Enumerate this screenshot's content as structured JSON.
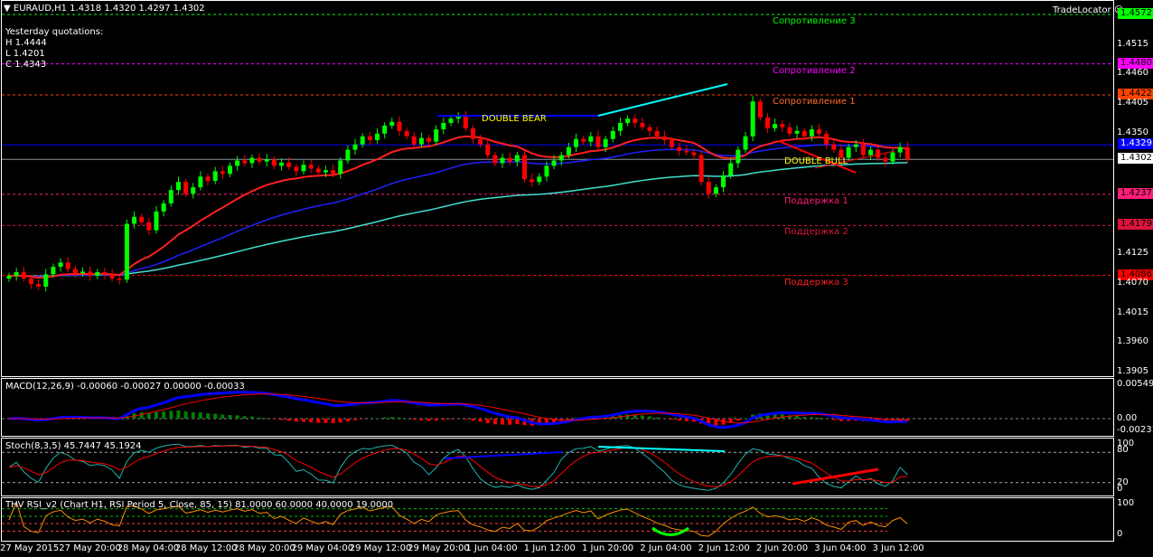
{
  "header": {
    "symbol_line": "EURAUD,H1  1.4318 1.4320 1.4297 1.4302",
    "tradelocator": "TradeLocator"
  },
  "yesterday": {
    "title": "Yesterday quotations:",
    "h": "H 1.4444",
    "l": "L 1.4201",
    "c": "C 1.4343"
  },
  "price_axis": [
    "1.4515",
    "1.4460",
    "1.4405",
    "1.4350",
    "1.4125",
    "1.4070",
    "1.4015",
    "1.3960",
    "1.3905"
  ],
  "levels": [
    {
      "name": "Сопротивление 3",
      "price": 1.4572,
      "label": "1.4572",
      "color": "#00ff00",
      "text_color": "#00ff00"
    },
    {
      "name": "Сопротивление 2",
      "price": 1.448,
      "label": "1.4480",
      "color": "#ff00ff",
      "text_color": "#ff00ff"
    },
    {
      "name": "Сопротивление 1",
      "price": 1.4422,
      "label": "1.4422",
      "color": "#ff4500",
      "text_color": "#ff6a2a"
    },
    {
      "name": "Поддержка 1",
      "price": 1.4237,
      "label": "1.4237",
      "color": "#ff1e78",
      "text_color": "#ff1e78"
    },
    {
      "name": "Поддержка 2",
      "price": 1.4179,
      "label": "1.4179",
      "color": "#dc143c",
      "text_color": "#dc143c"
    },
    {
      "name": "Поддержка 3",
      "price": 1.4086,
      "label": "1.4086",
      "color": "#ff0000",
      "text_color": "#ff2020"
    }
  ],
  "blue_line": {
    "price": 1.4329,
    "label": "1.4329",
    "color": "#0000ff"
  },
  "current_price": {
    "price": 1.4302,
    "label": "1.4302"
  },
  "annotations": {
    "bear": "DOUBLE  BEAR",
    "bull": "DOUBLE   BULL"
  },
  "macd": {
    "title": "MACD(12,26,9) -0.00060 -0.00027 0.00000 -0.00033",
    "axis": [
      "0.00549",
      "0.00",
      "-0.00231"
    ]
  },
  "stoch": {
    "title": "Stoch(8,3,5) 45.7447 45.1924",
    "axis": [
      "100",
      "80",
      "20",
      "0"
    ]
  },
  "rsi": {
    "title": "THV RSI_v2  (Chart H1,  RSI Period 5,  Close,  85,  15)  81.0000 60.0000 40.0000 19.0000",
    "axis": [
      "100",
      "0"
    ]
  },
  "time_axis": [
    "27 May 2015",
    "27 May 20:00",
    "28 May 04:00",
    "28 May 12:00",
    "28 May 20:00",
    "29 May 04:00",
    "29 May 12:00",
    "29 May 20:00",
    "1 Jun 04:00",
    "1 Jun 12:00",
    "1 Jun 20:00",
    "2 Jun 04:00",
    "2 Jun 12:00",
    "2 Jun 20:00",
    "3 Jun 04:00",
    "3 Jun 12:00"
  ],
  "chart_data": {
    "type": "candlestick",
    "closes": [
      1.4085,
      1.4092,
      1.408,
      1.407,
      1.4065,
      1.4088,
      1.4102,
      1.411,
      1.4098,
      1.409,
      1.4093,
      1.4085,
      1.4092,
      1.4088,
      1.408,
      1.4078,
      1.4182,
      1.4195,
      1.4185,
      1.417,
      1.4205,
      1.422,
      1.4245,
      1.426,
      1.4238,
      1.425,
      1.427,
      1.4262,
      1.428,
      1.4275,
      1.429,
      1.43,
      1.4295,
      1.4305,
      1.4298,
      1.4302,
      1.429,
      1.4296,
      1.4288,
      1.428,
      1.4292,
      1.4285,
      1.4278,
      1.4282,
      1.4275,
      1.43,
      1.432,
      1.433,
      1.4345,
      1.4338,
      1.435,
      1.4365,
      1.4372,
      1.4355,
      1.4345,
      1.433,
      1.4342,
      1.4335,
      1.4358,
      1.437,
      1.4378,
      1.4382,
      1.436,
      1.434,
      1.433,
      1.431,
      1.4295,
      1.4305,
      1.4298,
      1.431,
      1.4265,
      1.426,
      1.427,
      1.429,
      1.43,
      1.431,
      1.4325,
      1.434,
      1.4335,
      1.4345,
      1.4325,
      1.434,
      1.4355,
      1.437,
      1.4378,
      1.437,
      1.4362,
      1.4355,
      1.4345,
      1.4338,
      1.4325,
      1.4318,
      1.4315,
      1.431,
      1.426,
      1.4238,
      1.425,
      1.4272,
      1.4295,
      1.432,
      1.4345,
      1.441,
      1.438,
      1.436,
      1.4368,
      1.4362,
      1.435,
      1.4355,
      1.4345,
      1.4358,
      1.435,
      1.433,
      1.432,
      1.4305,
      1.4325,
      1.433,
      1.431,
      1.432,
      1.4305,
      1.4298,
      1.4315,
      1.4325,
      1.4302
    ],
    "ylim": [
      1.3905,
      1.4572
    ]
  }
}
